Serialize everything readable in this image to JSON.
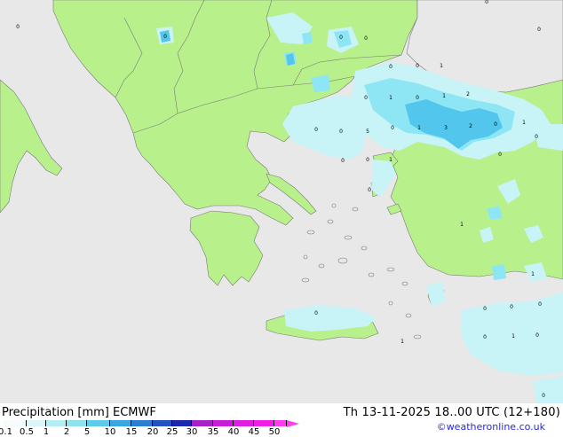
{
  "map": {
    "colors": {
      "sea": "#e8e8e8",
      "land": "#b8f08c",
      "precip_light": "#c8f4f8",
      "precip_mid": "#8ee6f4",
      "precip_heavy": "#52c6ec",
      "borders": "#7a7a7a"
    },
    "value_labels": [
      "0",
      "0",
      "0",
      "0",
      "0",
      "0",
      "0",
      "0",
      "1",
      "0",
      "1",
      "0",
      "1",
      "2",
      "1",
      "0",
      "0",
      "5",
      "1",
      "3",
      "2",
      "0",
      "0",
      "0",
      "1",
      "0",
      "0",
      "0",
      "1",
      "0",
      "0",
      "0",
      "0",
      "1",
      "0",
      "0",
      "1",
      "1",
      "0",
      "0"
    ]
  },
  "footer": {
    "title": "Precipitation [mm]  ECMWF",
    "datetime": "Th 13-11-2025 18..00 UTC (12+180)",
    "credit": "©weatheronline.co.uk"
  },
  "legend": {
    "ticks": [
      "0.1",
      "0.5",
      "1",
      "2",
      "5",
      "10",
      "15",
      "20",
      "25",
      "30",
      "35",
      "40",
      "45",
      "50"
    ],
    "colors": [
      "#f4fcfc",
      "#dcf6f8",
      "#b4eef4",
      "#8ee2f0",
      "#5ecce8",
      "#3aa8e0",
      "#2c7ed4",
      "#2452c4",
      "#1c26b0",
      "#a820c8",
      "#c81cd8",
      "#e01ce4",
      "#f01ce8",
      "#ff3cf0"
    ]
  }
}
